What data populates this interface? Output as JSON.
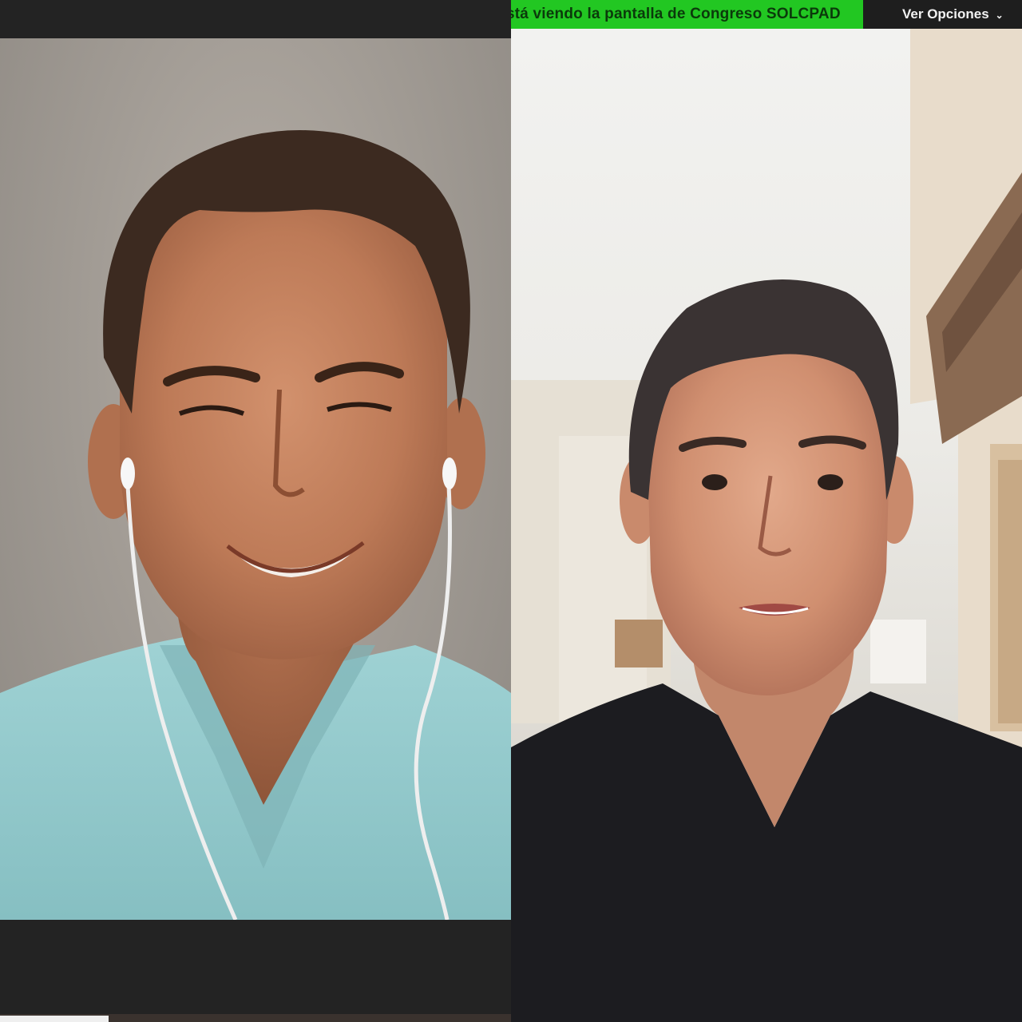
{
  "share_banner": {
    "text": "stá viendo la pantalla de  Congreso SOLCPAD",
    "color": "#22c722"
  },
  "view_options": {
    "label": "Ver Opciones",
    "icon": "chevron-down-icon"
  },
  "participants": [
    {
      "position": "left",
      "shirt_color": "#8fc7c9",
      "background_color": "#a29c95",
      "earphones": true
    },
    {
      "position": "right",
      "shirt_color": "#1c1c20",
      "background_color": "#ecebe7",
      "earphones": false
    }
  ]
}
